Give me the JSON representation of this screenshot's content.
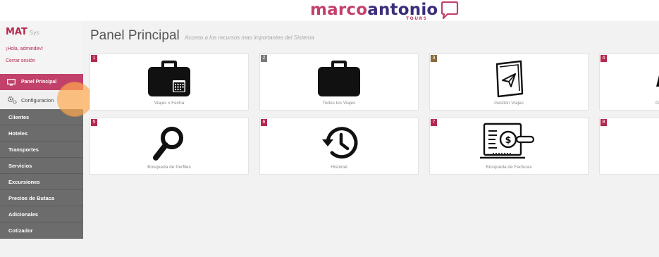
{
  "header": {
    "logo_part1": "marco",
    "logo_part2": "antonio",
    "logo_tours": "TOURS"
  },
  "sidebar": {
    "brand": "MAT",
    "brand_sub": "Sys",
    "greeting": "¡Hola, admindev!",
    "logout": "Cerrar sesión",
    "active_item": "Panel Principal",
    "config_item": "Configuracion",
    "items": [
      {
        "label": "Clientes"
      },
      {
        "label": "Hoteles"
      },
      {
        "label": "Transportes"
      },
      {
        "label": "Servicios"
      },
      {
        "label": "Excursiones"
      },
      {
        "label": "Precios de Butaca"
      },
      {
        "label": "Adicionales"
      },
      {
        "label": "Cotizador"
      }
    ]
  },
  "main": {
    "title": "Panel Principal",
    "subtitle": "Acceso a los recursos mas importantes del Sistema"
  },
  "cards": [
    {
      "num": "1",
      "label": "Viajes x Fecha",
      "icon": "briefcase-calendar-icon",
      "color": "#b5294e"
    },
    {
      "num": "2",
      "label": "Todos los Viajes",
      "icon": "briefcase-icon",
      "color": "#7a7a7a"
    },
    {
      "num": "3",
      "label": "Gestion Viajes",
      "icon": "paper-plane-icon",
      "color": "#8b6a3c"
    },
    {
      "num": "4",
      "label": "G",
      "icon": "partial-icon",
      "color": "#b5294e"
    },
    {
      "num": "5",
      "label": "Búsqueda de Perfiles",
      "icon": "magnifier-icon",
      "color": "#b5294e"
    },
    {
      "num": "6",
      "label": "Historial",
      "icon": "history-icon",
      "color": "#b5294e"
    },
    {
      "num": "7",
      "label": "Búsqueda de Facturas",
      "icon": "invoice-search-icon",
      "color": "#b5294e"
    },
    {
      "num": "8",
      "label": "",
      "icon": "partial-icon",
      "color": "#b5294e"
    }
  ]
}
